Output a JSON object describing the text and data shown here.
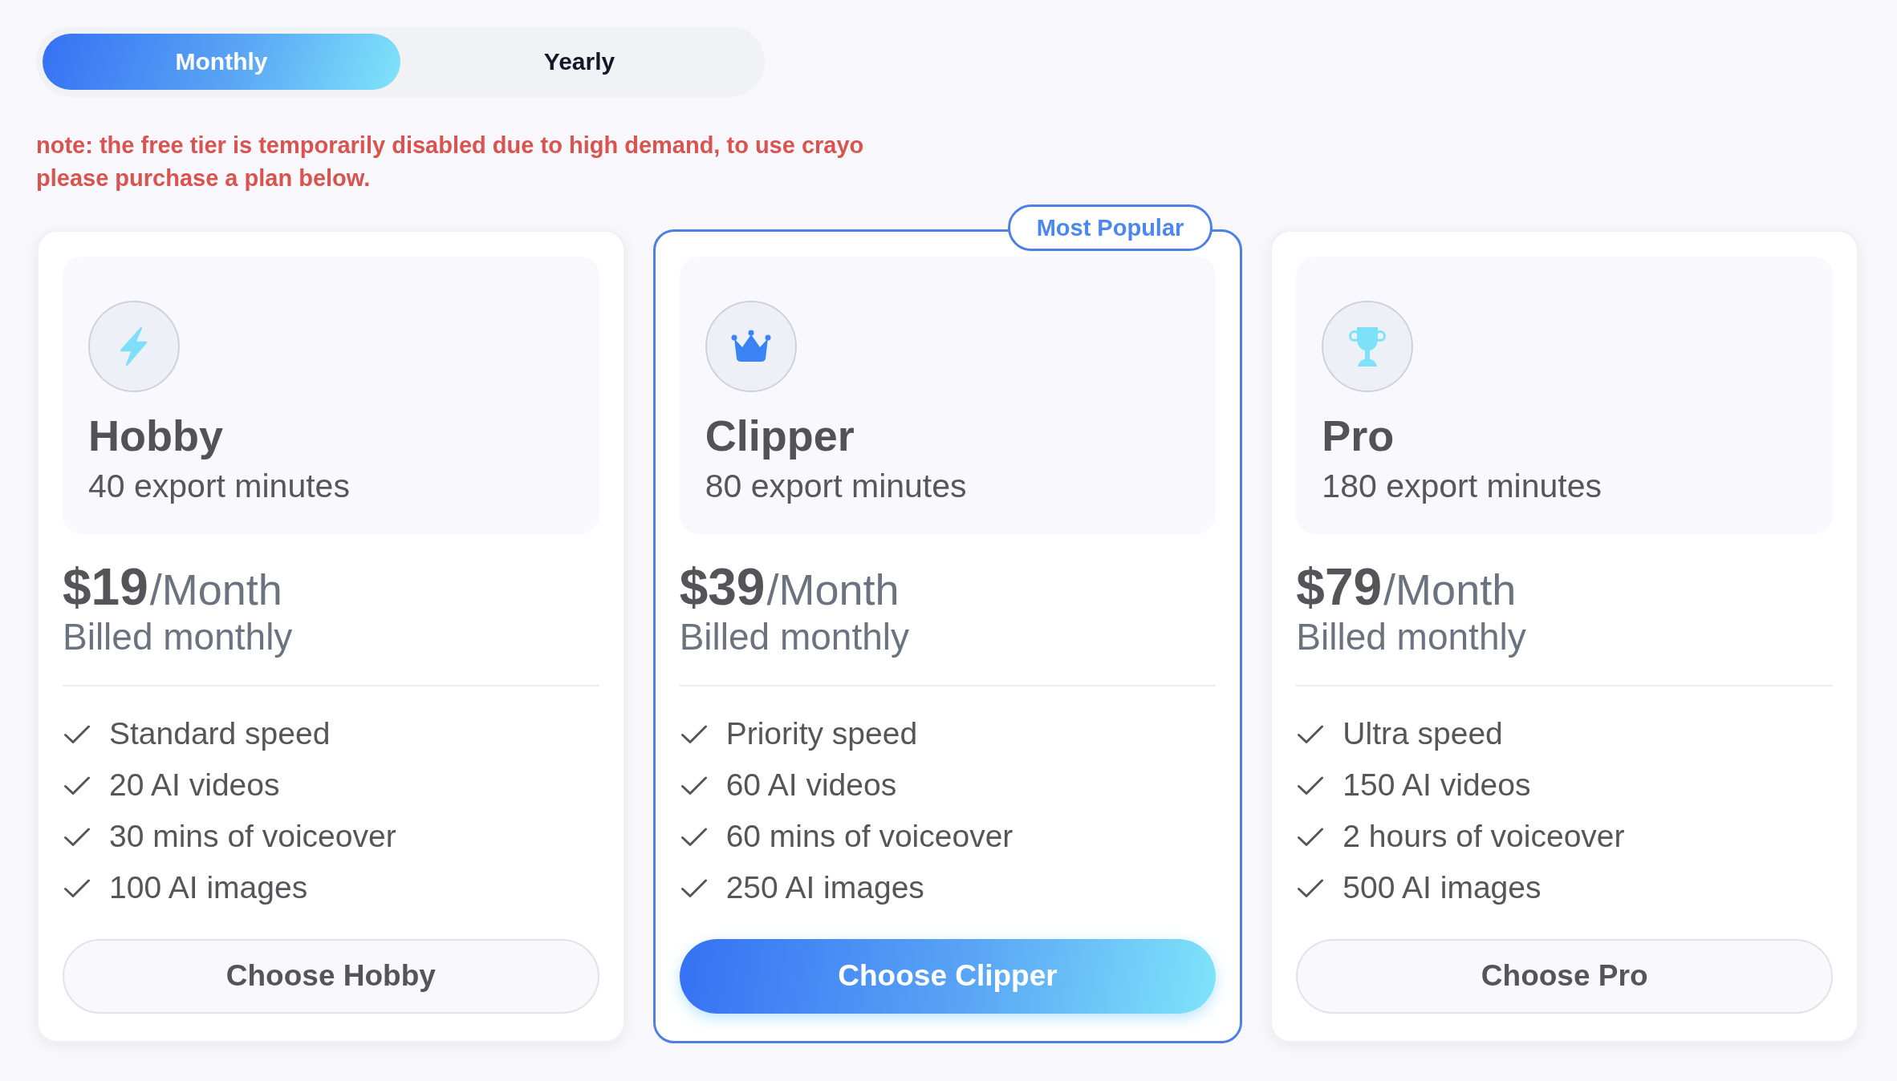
{
  "billing_toggle": {
    "options": [
      {
        "label": "Monthly",
        "selected": true
      },
      {
        "label": "Yearly",
        "selected": false
      }
    ]
  },
  "notice": "note: the free tier is temporarily disabled due to high demand, to use crayo please purchase a plan below.",
  "plans": [
    {
      "name": "Hobby",
      "minutes": "40 export minutes",
      "price": "$19",
      "period": "/Month",
      "billing": "Billed monthly",
      "features": [
        "Standard speed",
        "20 AI videos",
        "30 mins of voiceover",
        "100 AI images"
      ],
      "button": "Choose Hobby",
      "featured": false
    },
    {
      "name": "Clipper",
      "badge": "Most Popular",
      "minutes": "80 export minutes",
      "price": "$39",
      "period": "/Month",
      "billing": "Billed monthly",
      "features": [
        "Priority speed",
        "60 AI videos",
        "60 mins of voiceover",
        "250 AI images"
      ],
      "button": "Choose Clipper",
      "featured": true
    },
    {
      "name": "Pro",
      "minutes": "180 export minutes",
      "price": "$79",
      "period": "/Month",
      "billing": "Billed monthly",
      "features": [
        "Ultra speed",
        "150 AI videos",
        "2 hours of voiceover",
        "500 AI images"
      ],
      "button": "Choose Pro",
      "featured": false
    }
  ]
}
